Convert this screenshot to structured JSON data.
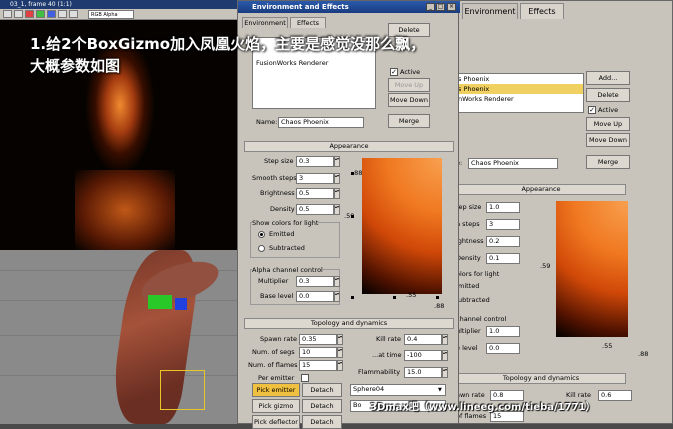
{
  "render_window": {
    "title": "03_1, frame 40 (1:1)",
    "channel": "RGB Alpha"
  },
  "dialog_front": {
    "title": "Environment and Effects",
    "tabs": [
      "Environment",
      "Effects"
    ],
    "effects_list": [
      "FusionWorks Renderer"
    ],
    "buttons": {
      "delete": "Delete",
      "active": "Active",
      "move_up": "Move Up",
      "move_down": "Move Down",
      "merge": "Merge"
    },
    "name_label": "Name:",
    "name_value": "Chaos Phoenix",
    "appearance": {
      "header": "Appearance",
      "step_size_label": "Step size",
      "step_size": "0.3",
      "smooth_steps_label": "Smooth steps",
      "smooth_steps": "3",
      "brightness_label": "Brightness",
      "brightness": "0.5",
      "density_label": "Density",
      "density": "0.5",
      "show_colors_label": "Show colors for light",
      "emitted_label": "Emitted",
      "subtracted_label": "Subtracted",
      "alpha_label": "Alpha channel control",
      "multiplier_label": "Multiplier",
      "multiplier": "0.3",
      "base_level_label": "Base level",
      "base_level": "0.0",
      "curve_labels": {
        "top": ".88",
        "mid": ".59",
        "bottom_x": ".55",
        "bottom_right": ".88"
      }
    },
    "topology": {
      "header": "Topology and dynamics",
      "spawn_rate_label": "Spawn rate",
      "spawn_rate": "0.35",
      "num_segs_label": "Num. of segs",
      "num_segs": "10",
      "num_flames_label": "Num. of flames",
      "num_flames": "15",
      "per_emitter_label": "Per emitter",
      "kill_rate_label": "Kill rate",
      "kill_rate": "0.4",
      "at_time_label": "...at time",
      "at_time": "-100",
      "flammability_label": "Flammability",
      "flammability": "15.0",
      "pick_emitter": "Pick emitter",
      "pick_gizmo": "Pick gizmo",
      "pick_deflector": "Pick deflector",
      "detach": "Detach",
      "emitter_value": "Sphere04",
      "gizmo_value": "Bo"
    }
  },
  "dialog_back": {
    "tabs": [
      "Environment",
      "Effects"
    ],
    "effects_list": [
      "s Phoenix",
      "s Phoenix",
      "nWorks Renderer"
    ],
    "buttons": {
      "add": "Add...",
      "delete": "Delete",
      "active": "Active",
      "move_up": "Move Up",
      "move_down": "Move Down",
      "merge": "Merge"
    },
    "name_label": "e:",
    "name_value": "Chaos Phoenix",
    "appearance_header": "Appearance",
    "step_size_label": "tep size",
    "step_size": "1.0",
    "smooth_steps_label": "h steps",
    "smooth_steps": "3",
    "brightness_label": "ightness",
    "brightness": "0.2",
    "density_label": "Density",
    "density": "0.1",
    "colors_label": "olors for light",
    "emitted_label": "mitted",
    "subtracted_label": "ubtracted",
    "channel_label": "channel control",
    "multiplier_label": "ultiplier",
    "multiplier": "1.0",
    "base_level_label": "e level",
    "base_level": "0.0",
    "curve_labels": {
      "mid": ".59",
      "bottom_x": ".55",
      "bottom_right": ".88"
    },
    "topology_header": "Topology and dynamics",
    "spawn_rate_label": "awn rate",
    "spawn_rate": "0.8",
    "kill_rate_label": "Kill rate",
    "kill_rate": "0.6",
    "num_flames_label": "of flames",
    "num_flames": "15"
  },
  "overlay": {
    "line1": "1.给2个BoxGizmo加入凤凰火焰，主要是感觉没那么飘，",
    "line2": "大概参数如图",
    "watermark": "3Dmax吧（www.lineeg.com/tieba/1771）"
  }
}
